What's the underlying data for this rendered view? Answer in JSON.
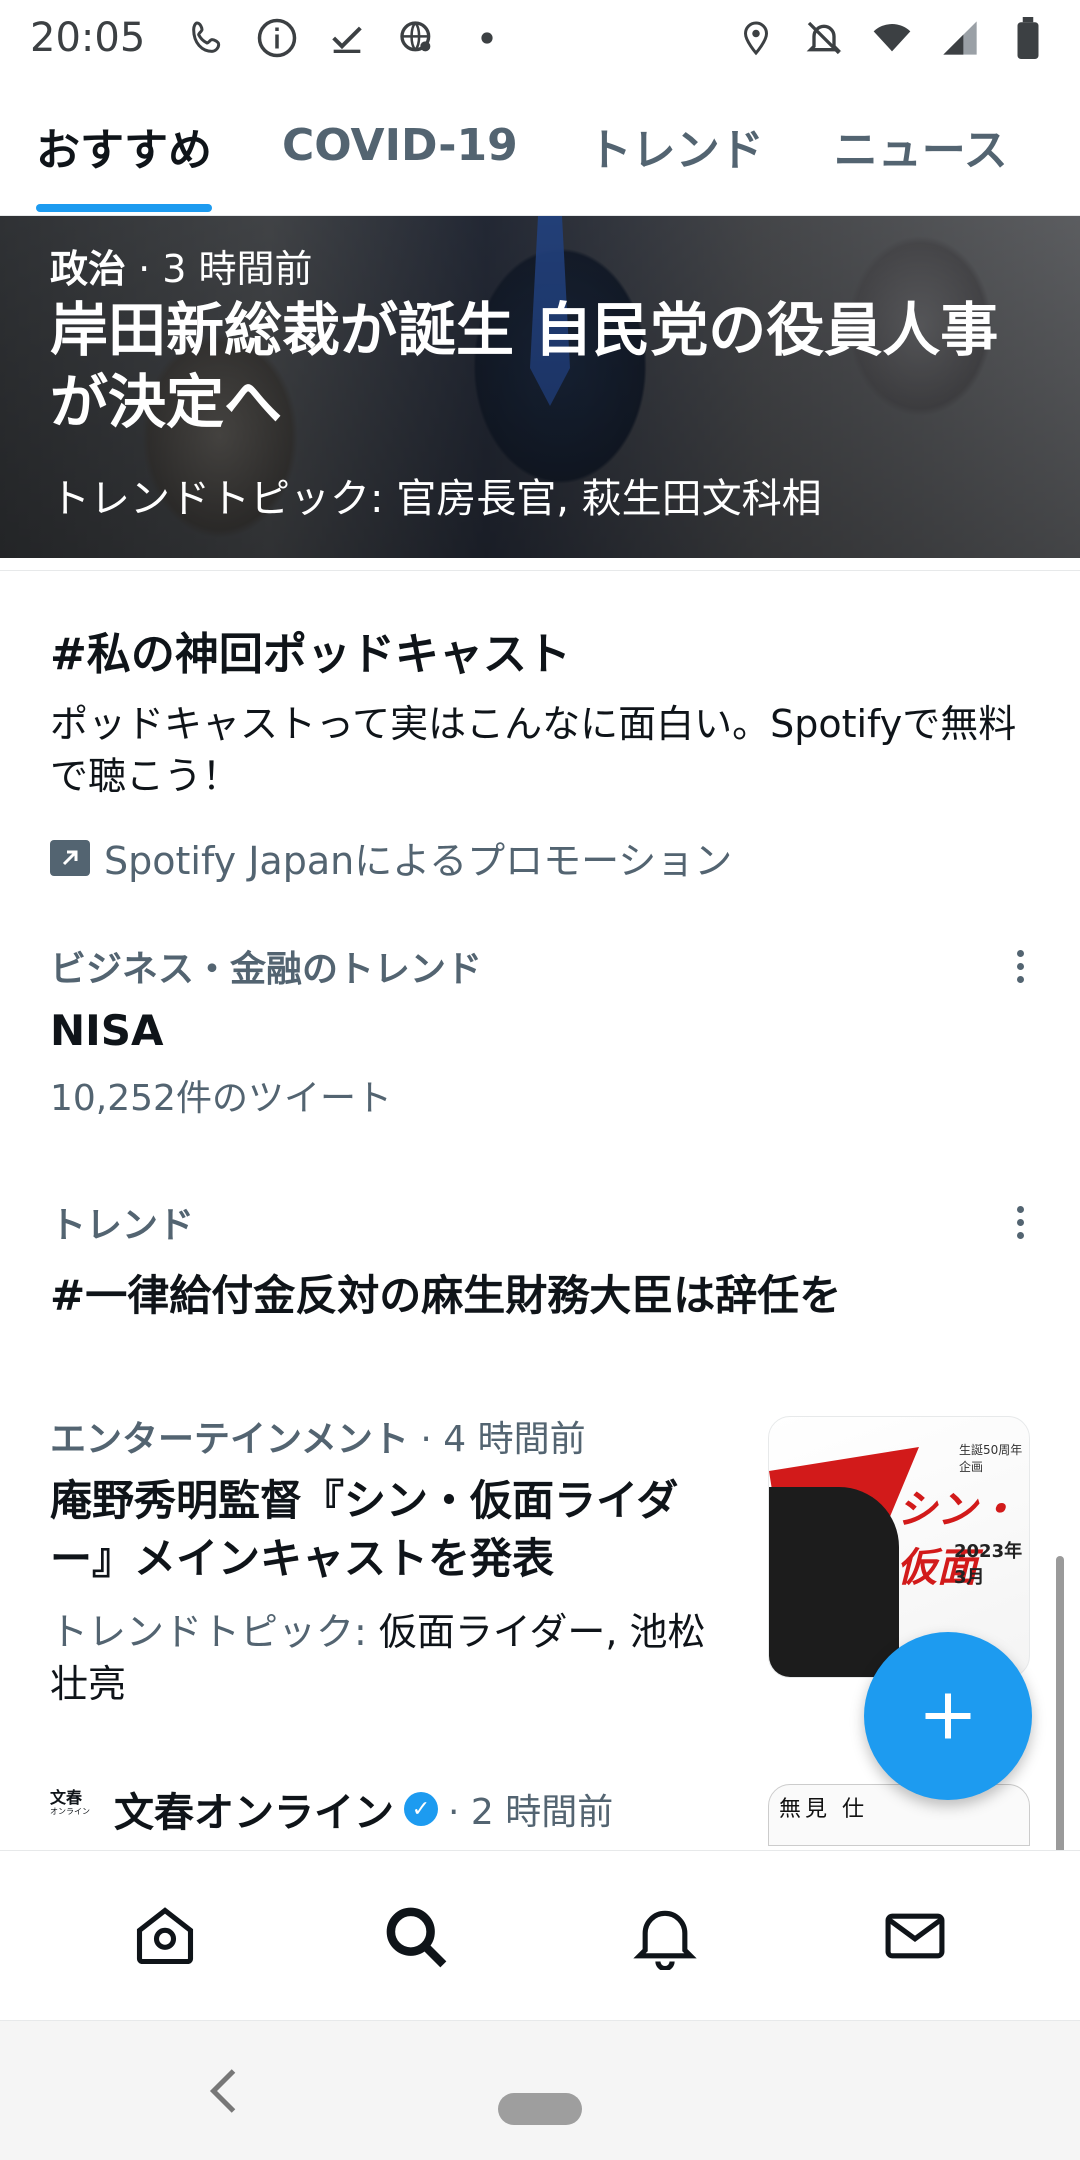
{
  "status_bar": {
    "time": "20:05"
  },
  "tabs": [
    {
      "label": "おすすめ",
      "active": true
    },
    {
      "label": "COVID-19",
      "active": false
    },
    {
      "label": "トレンド",
      "active": false
    },
    {
      "label": "ニュース",
      "active": false
    }
  ],
  "hero": {
    "category": "政治",
    "time": " · 3 時間前",
    "title": "岸田新総裁が誕生 自民党の役員人事が決定へ",
    "topics": "トレンドトピック: 官房長官, 萩生田文科相"
  },
  "promo": {
    "title": "#私の神回ポッドキャスト",
    "description": "ポッドキャストって実はこんなに面白い。Spotifyで無料で聴こう！",
    "promoted_by": "Spotify Japanによるプロモーション"
  },
  "trend1": {
    "category": "ビジネス・金融のトレンド",
    "topic": "NISA",
    "count": "10,252件のツイート"
  },
  "trend2": {
    "category": "トレンド",
    "topic": "#一律給付金反対の麻生財務大臣は辞任を"
  },
  "news1": {
    "category": "エンターテインメント",
    "time": " · 4 時間前",
    "headline": "庵野秀明監督『シン・仮面ライダー』メインキャストを発表",
    "trend_label": "トレンドトピック: ",
    "trend_topics": "仮面ライダー, 池松壮亮",
    "thumb_title": "シン・仮面",
    "thumb_small": "生誕50周年企画",
    "thumb_date": "2023年3月"
  },
  "news2": {
    "source_logo": "文春",
    "source_logo_sub": "オンライン",
    "source": "文春オンライン",
    "time": " · 2 時間前",
    "thumb_text": "無見 仕"
  },
  "colors": {
    "accent": "#1d9bf0",
    "text": "#0f1419",
    "secondary": "#536471"
  }
}
